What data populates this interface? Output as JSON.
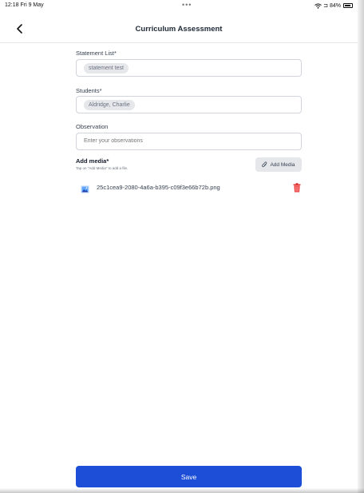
{
  "status": {
    "time": "12:18",
    "date": "Fri 9 May",
    "dots": "•••",
    "battery": "84%",
    "battery_level": 0.84
  },
  "nav": {
    "title": "Curriculum Assessment"
  },
  "form": {
    "statement": {
      "label": "Statement List*",
      "chip": "statement test"
    },
    "students": {
      "label": "Students*",
      "chip": "Aldridge, Charlie"
    },
    "observation": {
      "label": "Observation",
      "placeholder": "Enter your observations"
    },
    "media": {
      "title": "Add media*",
      "hint": "Tap on \"Add Media\" to add a file.",
      "button_label": "Add Media",
      "files": [
        {
          "name": "25c1cea9-2080-4a6a-b395-c09f3e66b72b.png",
          "icon": "image-icon"
        }
      ]
    }
  },
  "actions": {
    "save_label": "Save"
  },
  "colors": {
    "primary": "#1d4ed8",
    "danger": "#dc2626",
    "chip": "#e5e7eb"
  }
}
